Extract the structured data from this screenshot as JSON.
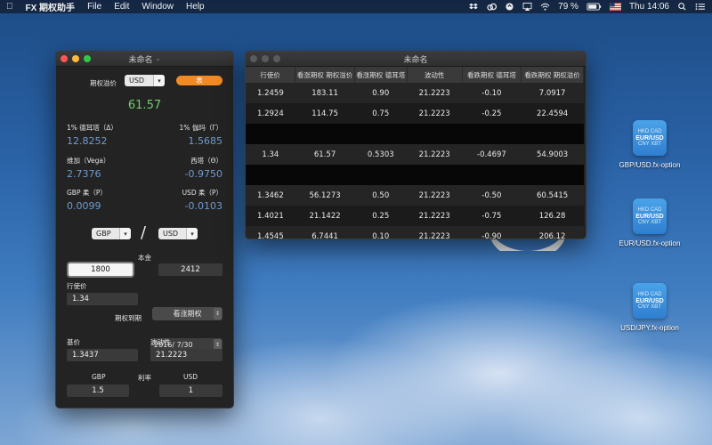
{
  "menubar": {
    "app_name": "FX 期权助手",
    "menus": [
      "File",
      "Edit",
      "Window",
      "Help"
    ],
    "battery": "79 %",
    "clock": "Thu 14:06"
  },
  "calculator": {
    "title": "未命名",
    "option_premium_label": "期权溢价",
    "premium_currency": "USD",
    "table_button": "表",
    "premium_value": "61.57",
    "delta_label": "1% 德耳塔（Δ）",
    "delta_value": "12.8252",
    "gamma_label": "1% 伽玛（Γ）",
    "gamma_value": "1.5685",
    "vega_label": "维加（Vega）",
    "vega_value": "2.7376",
    "theta_label": "西塔（Θ）",
    "theta_value": "-0.9750",
    "rho_gbp_label": "GBP 柔（P）",
    "rho_gbp_value": "0.0099",
    "rho_usd_label": "USD 柔（P）",
    "rho_usd_value": "-0.0103",
    "base_currency": "GBP",
    "slash": "/",
    "quote_currency": "USD",
    "principal_label": "本金",
    "principal_base": "1800",
    "principal_quote": "2412",
    "strike_label": "行使价",
    "strike_value": "1.34",
    "option_type": "看涨期权",
    "expiry_label": "期权到期",
    "expiry_value": "2016/  7/30",
    "spot_label": "基价",
    "spot_value": "1.3437",
    "vol_label": "波动性",
    "vol_value": "21.2223",
    "rate_base_label": "GBP",
    "rate_label": "利率",
    "rate_quote_label": "USD",
    "rate_base_value": "1.5",
    "rate_quote_value": "1"
  },
  "table_window": {
    "title": "未命名",
    "headers": [
      "行使价",
      "看涨期权 期权溢价",
      "看涨期权 德耳塔",
      "波动性",
      "看跌期权 德耳塔",
      "看跌期权 期权溢价"
    ],
    "rows": [
      [
        "1.2459",
        "183.11",
        "0.90",
        "21.2223",
        "-0.10",
        "7.0917"
      ],
      [
        "1.2924",
        "114.75",
        "0.75",
        "21.2223",
        "-0.25",
        "22.4594"
      ],
      [
        "",
        "",
        "",
        "",
        "",
        ""
      ],
      [
        "1.34",
        "61.57",
        "0.5303",
        "21.2223",
        "-0.4697",
        "54.9003"
      ],
      [
        "",
        "",
        "",
        "",
        "",
        ""
      ],
      [
        "1.3462",
        "56.1273",
        "0.50",
        "21.2223",
        "-0.50",
        "60.5415"
      ],
      [
        "1.4021",
        "21.1422",
        "0.25",
        "21.2223",
        "-0.75",
        "126.28"
      ],
      [
        "1.4545",
        "6.7441",
        "0.10",
        "21.2223",
        "-0.90",
        "206.12"
      ]
    ]
  },
  "desktop_icons": [
    {
      "name": "GBP/USD.fx-option",
      "tl": "HKD",
      "tr": "CAD",
      "mid": "EUR/USD",
      "bl": "CNY",
      "br": "XBT"
    },
    {
      "name": "EUR/USD.fx-option",
      "tl": "HKD",
      "tr": "CAD",
      "mid": "EUR/USD",
      "bl": "CNY",
      "br": "XBT"
    },
    {
      "name": "USD/JPY.fx-option",
      "tl": "HKD",
      "tr": "CAD",
      "mid": "EUR/USD",
      "bl": "CNY",
      "br": "XBT"
    }
  ]
}
